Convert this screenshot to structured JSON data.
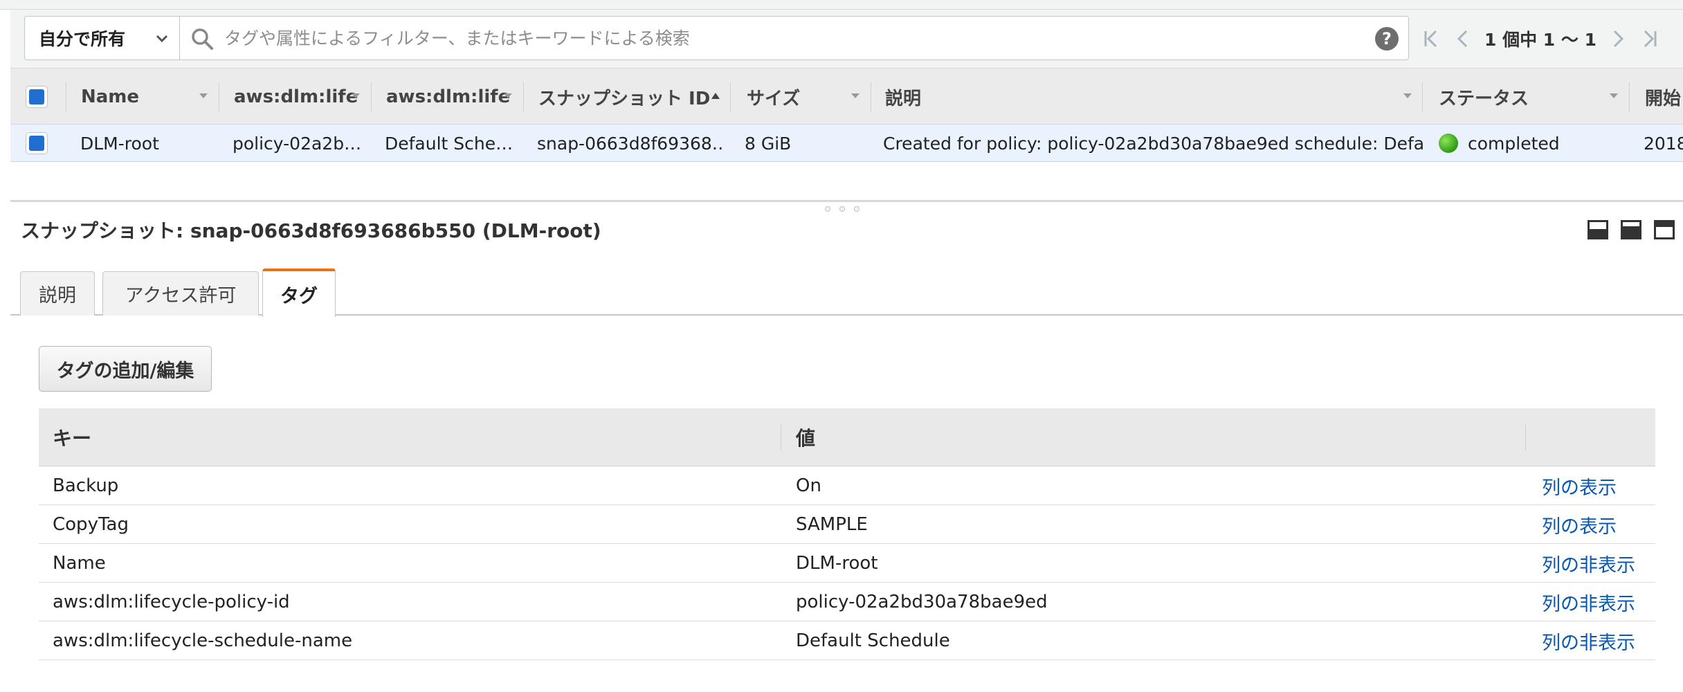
{
  "toolbar": {
    "owner_filter": "自分で所有",
    "search_placeholder": "タグや属性によるフィルター、またはキーワードによる検索",
    "help_label": "?",
    "pagination": "1 個中 1 〜 1"
  },
  "grid": {
    "columns": [
      "Name",
      "aws:dlm:lifec",
      "aws:dlm:lifec",
      "スナップショット ID",
      "サイズ",
      "説明",
      "ステータス",
      "開始"
    ],
    "row": {
      "name": "DLM-root",
      "policy_id": "policy-02a2b…",
      "schedule": "Default Sche…",
      "snapshot_id": "snap-0663d8f69368…",
      "size": "8 GiB",
      "description": "Created for policy: policy-02a2bd30a78bae9ed schedule: Defa…",
      "status": "completed",
      "started": "2018"
    }
  },
  "detail": {
    "title": "スナップショット: snap-0663d8f693686b550 (DLM-root)",
    "tabs": [
      "説明",
      "アクセス許可",
      "タグ"
    ],
    "active_tab": "タグ",
    "add_button": "タグの追加/編集",
    "table_headers": {
      "key": "キー",
      "value": "値"
    },
    "tags": [
      {
        "key": "Backup",
        "value": "On",
        "action": "列の表示"
      },
      {
        "key": "CopyTag",
        "value": "SAMPLE",
        "action": "列の表示"
      },
      {
        "key": "Name",
        "value": "DLM-root",
        "action": "列の非表示"
      },
      {
        "key": "aws:dlm:lifecycle-policy-id",
        "value": "policy-02a2bd30a78bae9ed",
        "action": "列の非表示"
      },
      {
        "key": "aws:dlm:lifecycle-schedule-name",
        "value": "Default Schedule",
        "action": "列の非表示"
      }
    ]
  },
  "colors": {
    "checkbox_fill": "#1f6fd1",
    "selected_row": "#e9f2fd",
    "active_tab_accent": "#ec7211",
    "link": "#0b58b2",
    "status_ok": "#2e9b12"
  },
  "icons": [
    "chevron-down-icon",
    "search-icon",
    "help-icon",
    "first-page-icon",
    "prev-page-icon",
    "next-page-icon",
    "last-page-icon",
    "sort-asc-icon",
    "layout-bottom-icon",
    "layout-split-icon",
    "layout-top-icon"
  ]
}
